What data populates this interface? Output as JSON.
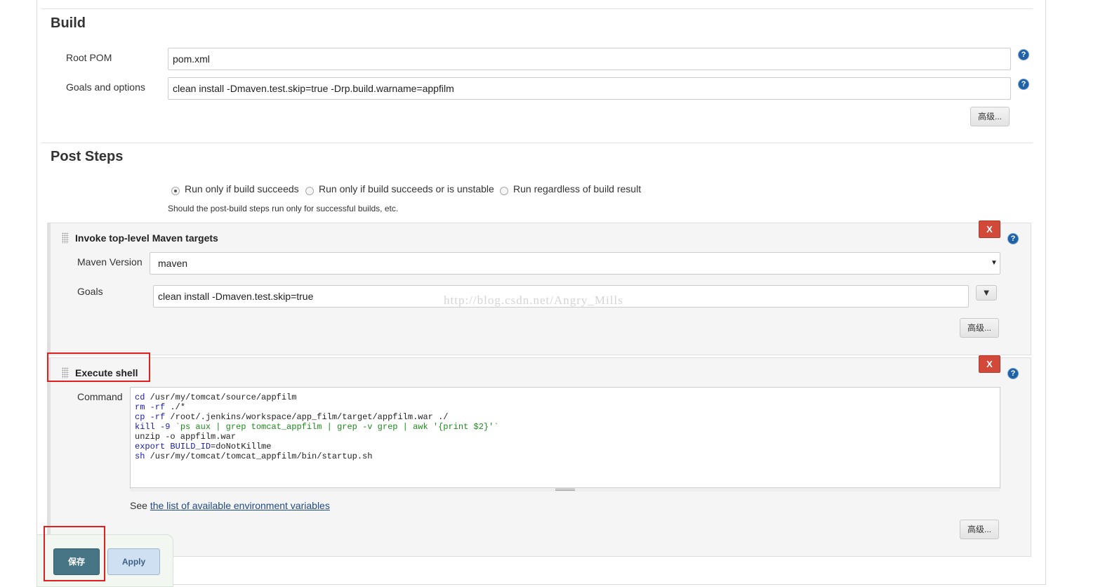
{
  "build": {
    "title": "Build",
    "root_pom_label": "Root POM",
    "root_pom_value": "pom.xml",
    "goals_label": "Goals and options",
    "goals_value": "clean install -Dmaven.test.skip=true -Drp.build.warname=appfilm",
    "advanced_label": "高级..."
  },
  "post_steps": {
    "title": "Post Steps",
    "options": [
      {
        "label": "Run only if build succeeds",
        "selected": true
      },
      {
        "label": "Run only if build succeeds or is unstable",
        "selected": false
      },
      {
        "label": "Run regardless of build result",
        "selected": false
      }
    ],
    "hint": "Should the post-build steps run only for successful builds, etc."
  },
  "maven_step": {
    "title": "Invoke top-level Maven targets",
    "delete_label": "X",
    "version_label": "Maven Version",
    "version_value": "maven",
    "goals_label": "Goals",
    "goals_value": "clean install -Dmaven.test.skip=true",
    "expand_icon": "triangle-down-icon",
    "advanced_label": "高级..."
  },
  "shell_step": {
    "title": "Execute shell",
    "delete_label": "X",
    "command_label": "Command",
    "command_lines": [
      "cd /usr/my/tomcat/source/appfilm",
      "rm -rf ./*",
      "cp -rf /root/.jenkins/workspace/app_film/target/appfilm.war ./",
      "kill -9 `ps aux | grep tomcat_appfilm | grep -v grep | awk '{print $2}'`",
      "unzip -o appfilm.war",
      "export BUILD_ID=doNotKillme",
      "sh /usr/my/tomcat/tomcat_appfilm/bin/startup.sh"
    ],
    "see_prefix": "See",
    "env_link": "the list of available environment variables",
    "advanced_label": "高级..."
  },
  "watermark": "http://blog.csdn.net/Angry_Mills",
  "footer": {
    "save_label": "保存",
    "apply_label": "Apply"
  },
  "colors": {
    "save_button": "#477585",
    "apply_button": "#cfe0f2",
    "delete_button": "#d24939",
    "annotation_red": "#e0201f",
    "help_icon": "#1f62a8"
  }
}
